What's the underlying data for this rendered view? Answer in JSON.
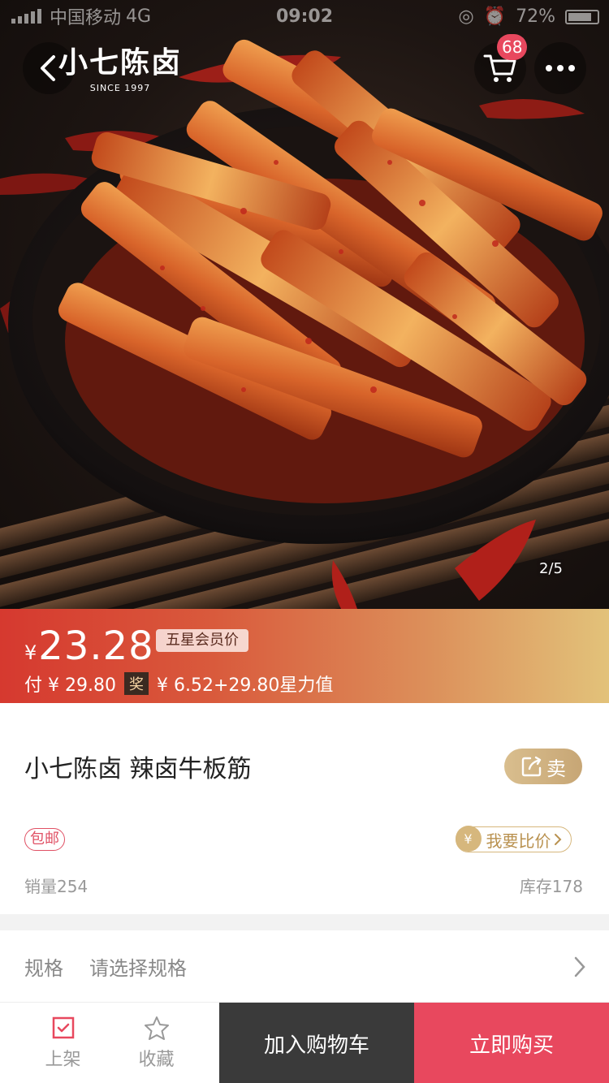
{
  "status_bar": {
    "carrier": "中国移动",
    "network": "4G",
    "time": "09:02",
    "battery": "72%"
  },
  "header": {
    "logo_text": "小七陈卤",
    "logo_since": "SINCE 1997",
    "cart_count": "68"
  },
  "gallery": {
    "pager": "2/5"
  },
  "price": {
    "currency": "¥",
    "amount": "23.28",
    "member_tag": "五星会员价",
    "pay_text": "付 ¥ 29.80",
    "award_tag": "奖",
    "award_text": "¥ 6.52+29.80星力值"
  },
  "product": {
    "title": "小七陈卤 辣卤牛板筋",
    "sell_label": "卖",
    "free_shipping": "包邮",
    "compare_coin": "¥",
    "compare_label": "我要比价",
    "sales": "销量254",
    "stock": "库存178"
  },
  "spec": {
    "label": "规格",
    "placeholder": "请选择规格"
  },
  "bottom_bar": {
    "list_label": "上架",
    "favorite_label": "收藏",
    "add_to_cart": "加入购物车",
    "buy_now": "立即购买"
  },
  "colors": {
    "accent": "#e8485e",
    "price_gradient_start": "#d6392f",
    "gold": "#d6b77d",
    "dark_button": "#3a3a3a"
  }
}
